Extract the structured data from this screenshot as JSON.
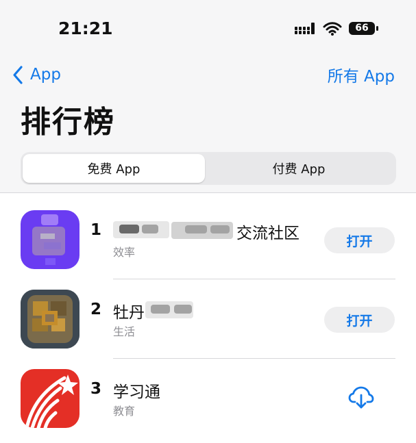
{
  "status_bar": {
    "time": "21:21",
    "battery": "66"
  },
  "navigation": {
    "back_label": "App",
    "right_link": "所有 App"
  },
  "page": {
    "title": "排行榜"
  },
  "segmented_control": {
    "selected": "免费 App",
    "options": [
      "免费 App",
      "付费 App"
    ]
  },
  "apps": [
    {
      "rank": "1",
      "name_visible": "交流社区",
      "category": "效率",
      "action": "打开",
      "icon_color": "#6a3cf2"
    },
    {
      "rank": "2",
      "name_visible": "牡丹",
      "category": "生活",
      "action": "打开",
      "icon_color": "#43505b"
    },
    {
      "rank": "3",
      "name_visible": "学习通",
      "category": "教育",
      "action": "download-icon",
      "icon_color": "#e42f26"
    }
  ],
  "colors": {
    "accent": "#1479e8",
    "background": "#f6f6f7",
    "secondary_text": "#8e8e93"
  }
}
